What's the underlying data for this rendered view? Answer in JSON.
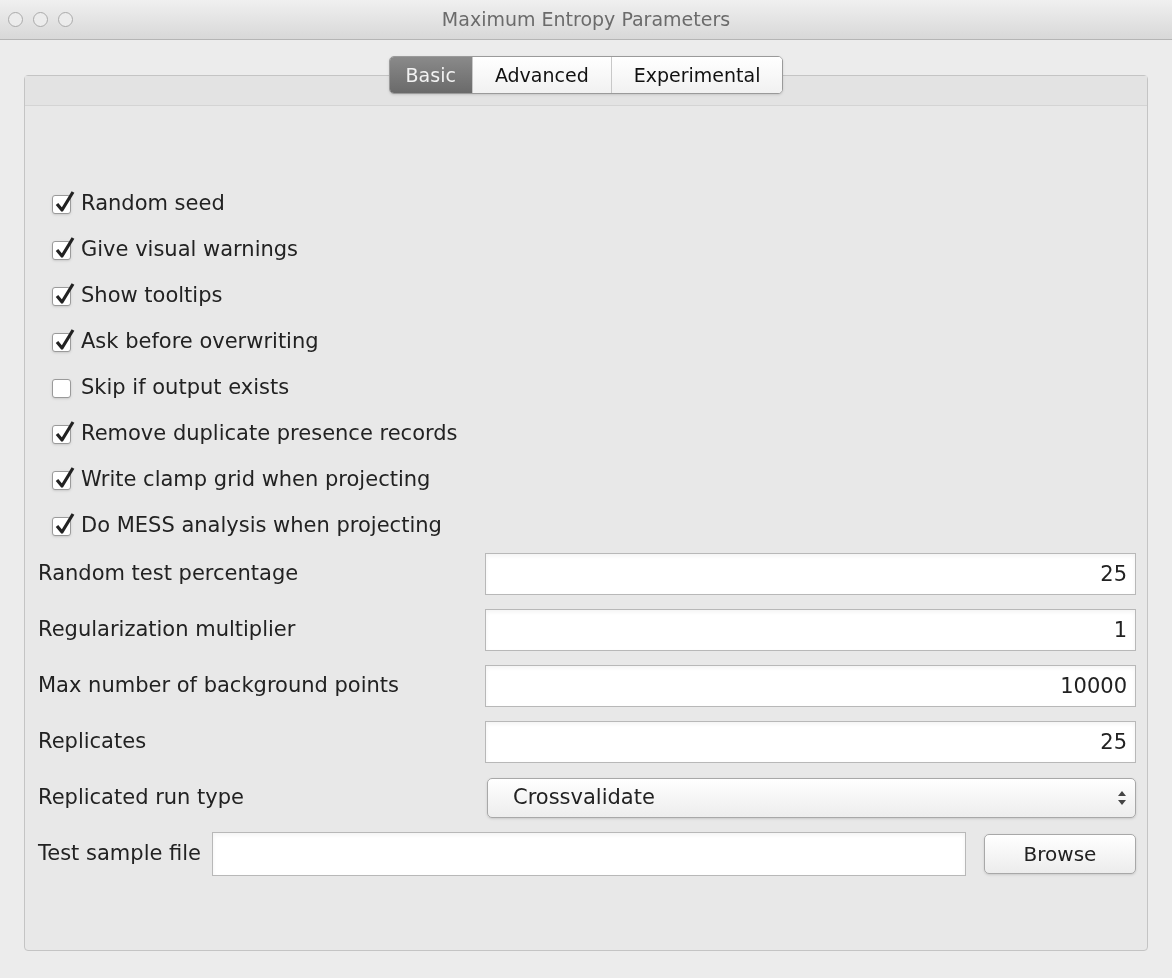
{
  "window": {
    "title": "Maximum Entropy Parameters"
  },
  "tabs": [
    {
      "label": "Basic",
      "selected": true
    },
    {
      "label": "Advanced",
      "selected": false
    },
    {
      "label": "Experimental",
      "selected": false
    }
  ],
  "options": [
    {
      "label": "Random seed",
      "checked": true
    },
    {
      "label": "Give visual warnings",
      "checked": true
    },
    {
      "label": "Show tooltips",
      "checked": true
    },
    {
      "label": "Ask before overwriting",
      "checked": true
    },
    {
      "label": "Skip if output exists",
      "checked": false
    },
    {
      "label": "Remove duplicate presence records",
      "checked": true
    },
    {
      "label": "Write clamp grid when projecting",
      "checked": true
    },
    {
      "label": "Do MESS analysis when projecting",
      "checked": true
    }
  ],
  "fields": [
    {
      "kind": "text",
      "label": "Random test percentage",
      "value": "25"
    },
    {
      "kind": "text",
      "label": "Regularization multiplier",
      "value": "1"
    },
    {
      "kind": "text",
      "label": "Max number of background points",
      "value": "10000"
    },
    {
      "kind": "text",
      "label": "Replicates",
      "value": "25"
    },
    {
      "kind": "select",
      "label": "Replicated run type",
      "value": "Crossvalidate"
    },
    {
      "kind": "file",
      "label": "Test sample file",
      "button": "Browse"
    }
  ]
}
